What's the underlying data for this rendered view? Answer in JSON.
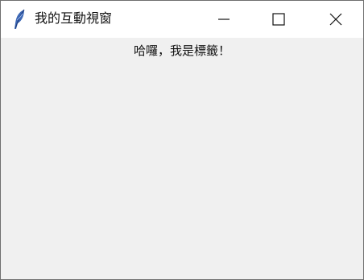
{
  "window": {
    "title": "我的互動視窗",
    "app_icon": "feather-icon",
    "controls": {
      "minimize": "minimize-icon",
      "maximize": "maximize-icon",
      "close": "close-icon"
    }
  },
  "content": {
    "label_text": "哈囉，我是標籤！"
  },
  "colors": {
    "titlebar_background": "#ffffff",
    "window_background": "#f0f0f0",
    "border": "#6f6f6f",
    "text": "#111111"
  }
}
